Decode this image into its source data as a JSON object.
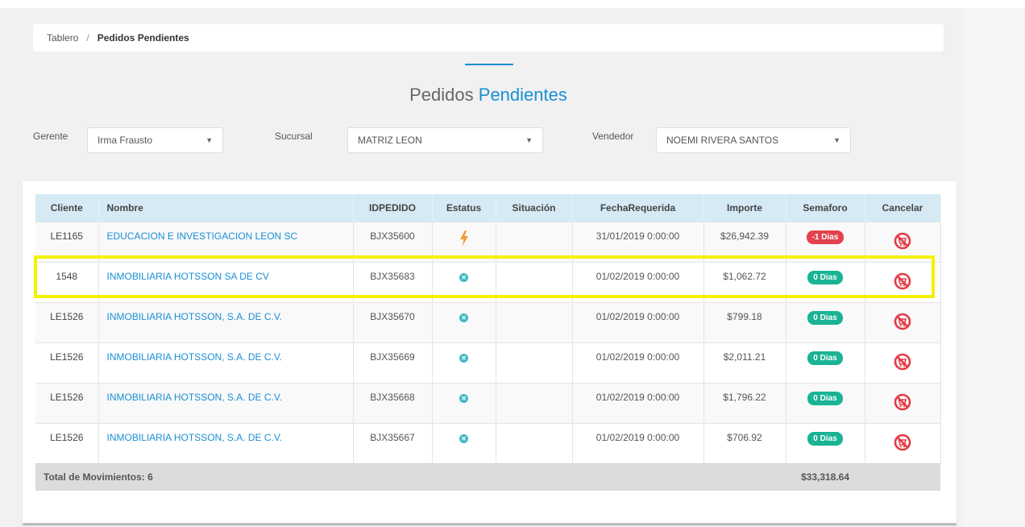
{
  "breadcrumb": {
    "home": "Tablero",
    "separator": "/",
    "current": "Pedidos Pendientes"
  },
  "page_title": {
    "part1": "Pedidos",
    "part2": "Pendientes"
  },
  "filters": {
    "gerente": {
      "label": "Gerente",
      "value": "Irma Frausto"
    },
    "sucursal": {
      "label": "Sucursal",
      "value": "MATRIZ LEON"
    },
    "vendedor": {
      "label": "Vendedor",
      "value": "NOEMI RIVERA SANTOS"
    }
  },
  "table": {
    "headers": [
      "Cliente",
      "Nombre",
      "IDPEDIDO",
      "Estatus",
      "Situación",
      "FechaRequerida",
      "Importe",
      "Semaforo",
      "Cancelar"
    ],
    "rows": [
      {
        "cliente": "LE1165",
        "nombre": "EDUCACION E INVESTIGACION LEON SC",
        "idpedido": "BJX35600",
        "estatus": "lightning-icon",
        "situacion": "",
        "fecha": "31/01/2019 0:00:00",
        "importe": "$26,942.39",
        "semaforo": "-1 Dias",
        "semaforo_color": "#e2424e"
      },
      {
        "cliente": "1548",
        "nombre": "INMOBILIARIA HOTSSON SA DE CV",
        "idpedido": "BJX35683",
        "estatus": "x-circle-icon",
        "situacion": "",
        "fecha": "01/02/2019 0:00:00",
        "importe": "$1,062.72",
        "semaforo": "0 Dias",
        "semaforo_color": "#1ab394"
      },
      {
        "cliente": "LE1526",
        "nombre": "INMOBILIARIA HOTSSON, S.A. DE C.V.",
        "idpedido": "BJX35670",
        "estatus": "x-circle-icon",
        "situacion": "",
        "fecha": "01/02/2019 0:00:00",
        "importe": "$799.18",
        "semaforo": "0 Dias",
        "semaforo_color": "#1ab394"
      },
      {
        "cliente": "LE1526",
        "nombre": "INMOBILIARIA HOTSSON, S.A. DE C.V.",
        "idpedido": "BJX35669",
        "estatus": "x-circle-icon",
        "situacion": "",
        "fecha": "01/02/2019 0:00:00",
        "importe": "$2,011.21",
        "semaforo": "0 Dias",
        "semaforo_color": "#1ab394"
      },
      {
        "cliente": "LE1526",
        "nombre": "INMOBILIARIA HOTSSON, S.A. DE C.V.",
        "idpedido": "BJX35668",
        "estatus": "x-circle-icon",
        "situacion": "",
        "fecha": "01/02/2019 0:00:00",
        "importe": "$1,796.22",
        "semaforo": "0 Dias",
        "semaforo_color": "#1ab394"
      },
      {
        "cliente": "LE1526",
        "nombre": "INMOBILIARIA HOTSSON, S.A. DE C.V.",
        "idpedido": "BJX35667",
        "estatus": "x-circle-icon",
        "situacion": "",
        "fecha": "01/02/2019 0:00:00",
        "importe": "$706.92",
        "semaforo": "0 Dias",
        "semaforo_color": "#1ab394"
      }
    ],
    "footer": {
      "total_label": "Total de Movimientos: 6",
      "total_amount": "$33,318.64"
    }
  },
  "colors": {
    "accent": "#1a8fd6",
    "header_bg": "#d6eaf5",
    "highlight": "#f5f200",
    "cancel_icon": "#e53945"
  }
}
